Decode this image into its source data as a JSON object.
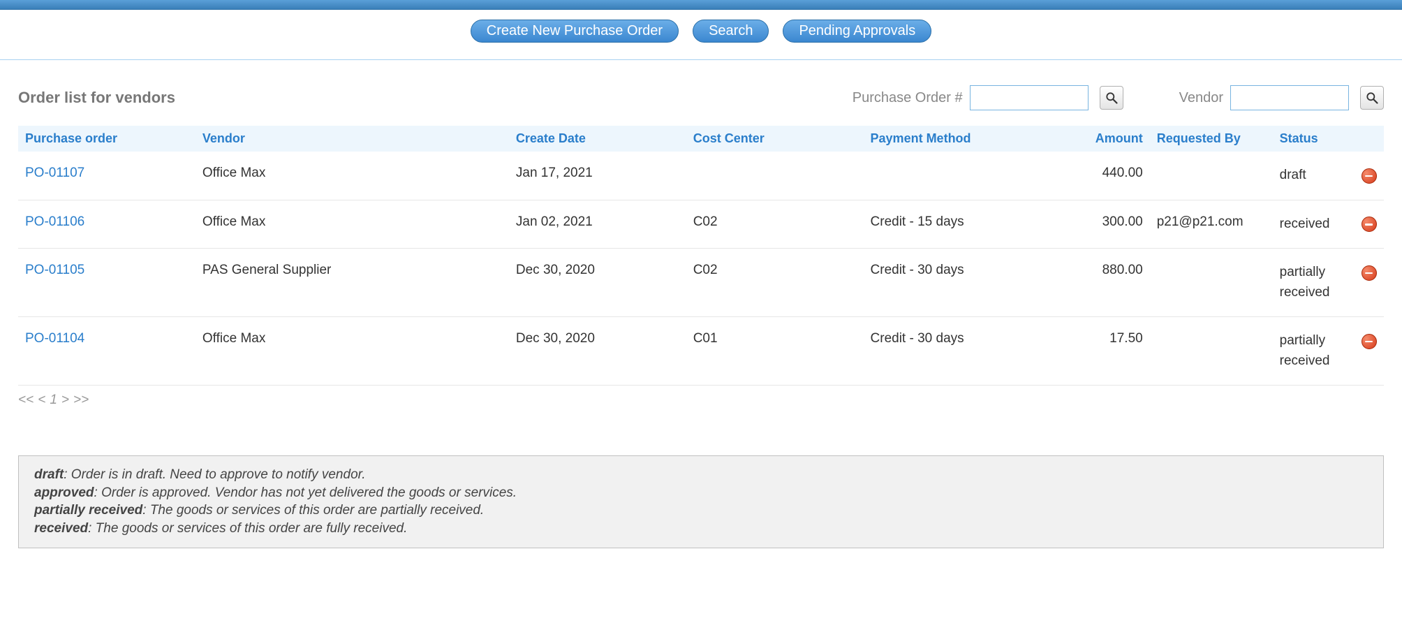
{
  "actions": {
    "create": "Create New Purchase Order",
    "search": "Search",
    "pending": "Pending Approvals"
  },
  "page_title": "Order list for vendors",
  "filters": {
    "po_label": "Purchase Order #",
    "po_value": "",
    "vendor_label": "Vendor",
    "vendor_value": ""
  },
  "columns": {
    "po": "Purchase order",
    "vendor": "Vendor",
    "create_date": "Create Date",
    "cost_center": "Cost Center",
    "payment_method": "Payment Method",
    "amount": "Amount",
    "requested_by": "Requested By",
    "status": "Status"
  },
  "rows": [
    {
      "po": "PO-01107",
      "vendor": "Office Max",
      "create_date": "Jan 17, 2021",
      "cost_center": "",
      "payment_method": "",
      "amount": "440.00",
      "requested_by": "",
      "status": "draft"
    },
    {
      "po": "PO-01106",
      "vendor": "Office Max",
      "create_date": "Jan 02, 2021",
      "cost_center": "C02",
      "payment_method": "Credit - 15 days",
      "amount": "300.00",
      "requested_by": "p21@p21.com",
      "status": "received"
    },
    {
      "po": "PO-01105",
      "vendor": "PAS General Supplier",
      "create_date": "Dec 30, 2020",
      "cost_center": "C02",
      "payment_method": "Credit - 30 days",
      "amount": "880.00",
      "requested_by": "",
      "status": "partially received"
    },
    {
      "po": "PO-01104",
      "vendor": "Office Max",
      "create_date": "Dec 30, 2020",
      "cost_center": "C01",
      "payment_method": "Credit - 30 days",
      "amount": "17.50",
      "requested_by": "",
      "status": "partially received"
    }
  ],
  "pager": {
    "first": "<<",
    "prev": "<",
    "current": "1",
    "next": ">",
    "last": ">>"
  },
  "legend": [
    {
      "term": "draft",
      "desc": ": Order is in draft. Need to approve to notify vendor."
    },
    {
      "term": "approved",
      "desc": ": Order is approved. Vendor has not yet delivered the goods or services."
    },
    {
      "term": "partially received",
      "desc": ": The goods or services of this order are partially received."
    },
    {
      "term": "received",
      "desc": ": The goods or services of this order are fully received."
    }
  ]
}
